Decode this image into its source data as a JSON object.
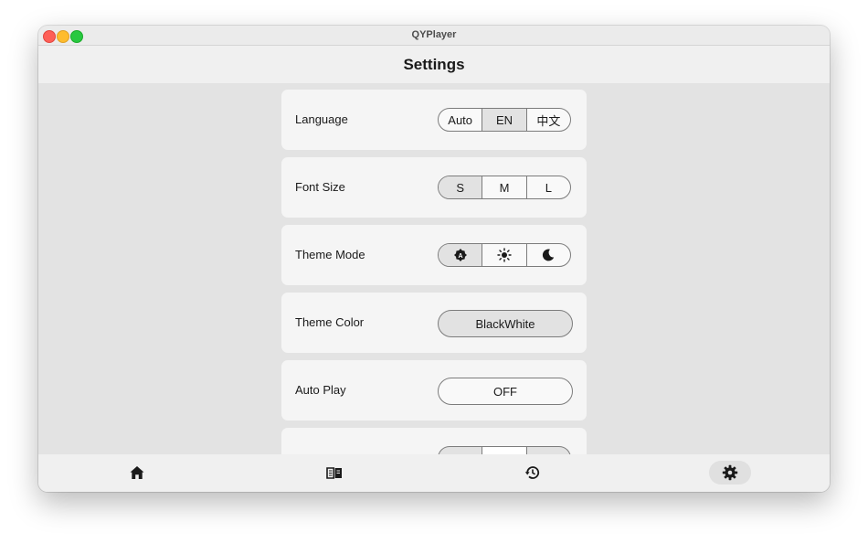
{
  "window": {
    "title": "QYPlayer"
  },
  "header": {
    "title": "Settings"
  },
  "settings": {
    "language": {
      "label": "Language",
      "options": [
        "Auto",
        "EN",
        "中文"
      ],
      "selected": "EN"
    },
    "font_size": {
      "label": "Font Size",
      "options": [
        "S",
        "M",
        "L"
      ],
      "selected": "S"
    },
    "theme_mode": {
      "label": "Theme Mode",
      "options": [
        "auto-mode-icon",
        "light-mode-sun-icon",
        "dark-mode-moon-icon"
      ],
      "selected": "auto-mode-icon"
    },
    "theme_color": {
      "label": "Theme Color",
      "value": "BlackWhite"
    },
    "auto_play": {
      "label": "Auto Play",
      "value": "OFF"
    }
  },
  "nav": {
    "items": [
      {
        "icon": "home-icon",
        "active": false
      },
      {
        "icon": "book-icon",
        "active": false
      },
      {
        "icon": "history-icon",
        "active": false
      },
      {
        "icon": "gear-icon",
        "active": true
      }
    ]
  },
  "colors": {
    "card_bg": "#f5f5f5",
    "content_bg": "#e3e3e3",
    "selected_segment": "#e2e2e2",
    "border": "#7c7c7c"
  }
}
